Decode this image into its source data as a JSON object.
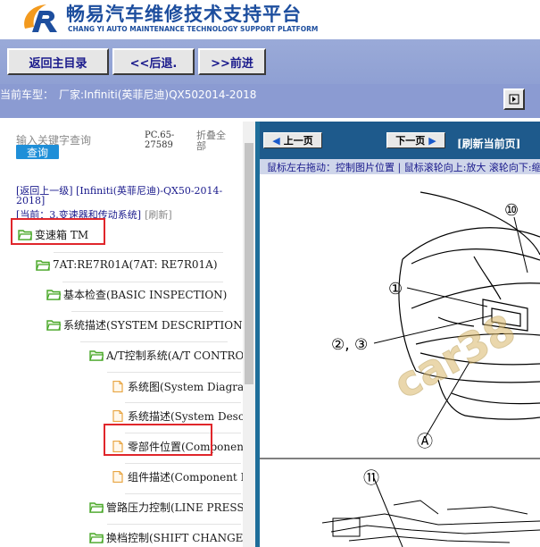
{
  "header": {
    "title": "畅易汽车维修技术支持平台",
    "subtitle": "CHANG YI AUTO MAINTENANCE TECHNOLOGY SUPPORT PLATFORM"
  },
  "toolbar": {
    "home_label": "返回主目录",
    "back_label": "<<后退.",
    "forward_label": ">>前进"
  },
  "car": {
    "label": "当前车型：",
    "value": "厂家:Infiniti(英菲尼迪)QX502014-2018"
  },
  "search": {
    "placeholder": "输入关键字查询",
    "button": "查询",
    "code": "PC.65-27589",
    "collapse": "折叠全部"
  },
  "nav": {
    "back_up": "[返回上一级]",
    "path": "[Infiniti(英菲尼迪)-QX50-2014-2018]",
    "current": "[当前：3.变速器和传动系统]",
    "refresh": "[刷新]"
  },
  "tree": [
    {
      "label": "变速箱 TM",
      "type": "folder",
      "highlight": true
    },
    {
      "label": "7AT:RE7R01A(7AT: RE7R01A)",
      "type": "folder"
    },
    {
      "label": "基本检查(BASIC INSPECTION)",
      "type": "folder"
    },
    {
      "label": "系统描述(SYSTEM DESCRIPTION)",
      "type": "folder"
    },
    {
      "label": "A/T控制系统(A/T CONTRO",
      "type": "folder"
    },
    {
      "label": "系统图(System Diagram",
      "type": "page"
    },
    {
      "label": "系统描述(System Descr",
      "type": "page"
    },
    {
      "label": "零部件位置(Componen",
      "type": "page",
      "highlight": true
    },
    {
      "label": "组件描述(Component D",
      "type": "page"
    },
    {
      "label": "管路压力控制(LINE PRESSU",
      "type": "folder"
    },
    {
      "label": "换档控制(SHIFT CHANGE C",
      "type": "folder"
    }
  ],
  "viewer": {
    "prev": "上一页",
    "next": "下一页",
    "refresh_first": "[刷新当前页]",
    "hint": "鼠标左右拖动：控制图片位置 | 鼠标滚轮向上:放大  滚轮向下:缩小"
  },
  "diagram": {
    "callouts": [
      "⑩",
      "①",
      "②, ③",
      "Ⓐ",
      "⑪"
    ],
    "watermark": "car38"
  },
  "colors": {
    "brand_blue": "#1d4e9e",
    "toolbar_bg": "#9aaad8",
    "panel_header": "#1e5a8c",
    "highlight": "#e0262b",
    "folder_green": "#4aa82a"
  }
}
